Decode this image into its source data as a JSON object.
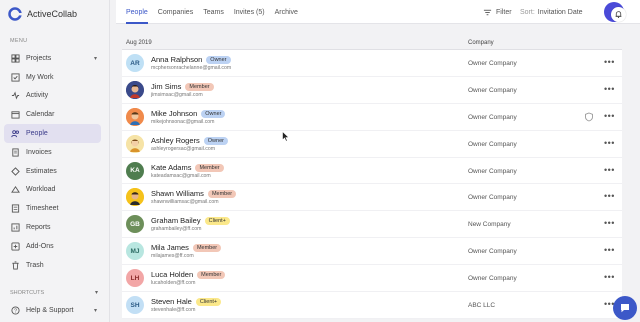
{
  "app": {
    "name": "ActiveCollab"
  },
  "colors": {
    "accent": "#3c58c8",
    "owner_badge": "#bcd2f3",
    "member_badge": "#f2c7b7",
    "client_badge": "#fbe88a"
  },
  "sidebar": {
    "menu_label": "MENU",
    "items": [
      {
        "label": "Projects",
        "icon": "projects-icon",
        "chevron": "▾"
      },
      {
        "label": "My Work",
        "icon": "my-work-icon"
      },
      {
        "label": "Activity",
        "icon": "activity-icon"
      },
      {
        "label": "Calendar",
        "icon": "calendar-icon"
      },
      {
        "label": "People",
        "icon": "people-icon",
        "active": true
      },
      {
        "label": "Invoices",
        "icon": "invoices-icon"
      },
      {
        "label": "Estimates",
        "icon": "estimates-icon"
      },
      {
        "label": "Workload",
        "icon": "workload-icon"
      },
      {
        "label": "Timesheet",
        "icon": "timesheet-icon"
      },
      {
        "label": "Reports",
        "icon": "reports-icon"
      },
      {
        "label": "Add-Ons",
        "icon": "add-ons-icon"
      },
      {
        "label": "Trash",
        "icon": "trash-icon"
      }
    ],
    "shortcuts_label": "SHORTCUTS",
    "help_label": "Help & Support"
  },
  "topbar": {
    "tabs": [
      "People",
      "Companies",
      "Teams",
      "Invites (5)",
      "Archive"
    ],
    "filter_label": "Filter",
    "sort_prefix": "Sort:",
    "sort_value": "Invitation Date"
  },
  "list": {
    "group_label": "Aug 2019",
    "company_header": "Company",
    "people": [
      {
        "initials": "AR",
        "name": "Anna Ralphson",
        "role": "Owner",
        "email": "mcphersonrachelanne@gmail.com",
        "company": "Owner Company",
        "avatar_bg": "#bfe0f5",
        "avatar_fg": "#2a5a85"
      },
      {
        "initials": "",
        "name": "Jim Sims",
        "role": "Member",
        "email": "jimsimsac@gmail.com",
        "company": "Owner Company",
        "avatar_bg": "#3a4a8a",
        "avatar_fg": "#fff"
      },
      {
        "initials": "",
        "name": "Mike Johnson",
        "role": "Owner",
        "email": "mikejohnsonac@gmail.com",
        "company": "Owner Company",
        "avatar_bg": "#f08a4b",
        "avatar_fg": "#fff",
        "shield": true
      },
      {
        "initials": "",
        "name": "Ashley Rogers",
        "role": "Owner",
        "email": "ashleyrogersac@gmail.com",
        "company": "Owner Company",
        "avatar_bg": "#f6e3a6",
        "avatar_fg": "#6a4a1a"
      },
      {
        "initials": "KA",
        "name": "Kate Adams",
        "role": "Member",
        "email": "kateadamsac@gmail.com",
        "company": "Owner Company",
        "avatar_bg": "#4f7d4f",
        "avatar_fg": "#fff"
      },
      {
        "initials": "",
        "name": "Shawn Williams",
        "role": "Member",
        "email": "shawnwilliamsac@gmail.com",
        "company": "Owner Company",
        "avatar_bg": "#f5c21b",
        "avatar_fg": "#3a2a00"
      },
      {
        "initials": "GB",
        "name": "Graham Bailey",
        "role": "Client+",
        "email": "grahambailey@ff.com",
        "company": "New Company",
        "avatar_bg": "#6d8f5a",
        "avatar_fg": "#fff"
      },
      {
        "initials": "MJ",
        "name": "Mila James",
        "role": "Member",
        "email": "milajames@ff.com",
        "company": "Owner Company",
        "avatar_bg": "#b8e6e0",
        "avatar_fg": "#2a6a62"
      },
      {
        "initials": "LH",
        "name": "Luca Holden",
        "role": "Member",
        "email": "lucaholden@ff.com",
        "company": "Owner Company",
        "avatar_bg": "#f2a6a6",
        "avatar_fg": "#8a2a2a"
      },
      {
        "initials": "SH",
        "name": "Steven Hale",
        "role": "Client+",
        "email": "stevenhale@ff.com",
        "company": "ABC LLC",
        "avatar_bg": "#c2dff5",
        "avatar_fg": "#2a5a85"
      }
    ]
  }
}
